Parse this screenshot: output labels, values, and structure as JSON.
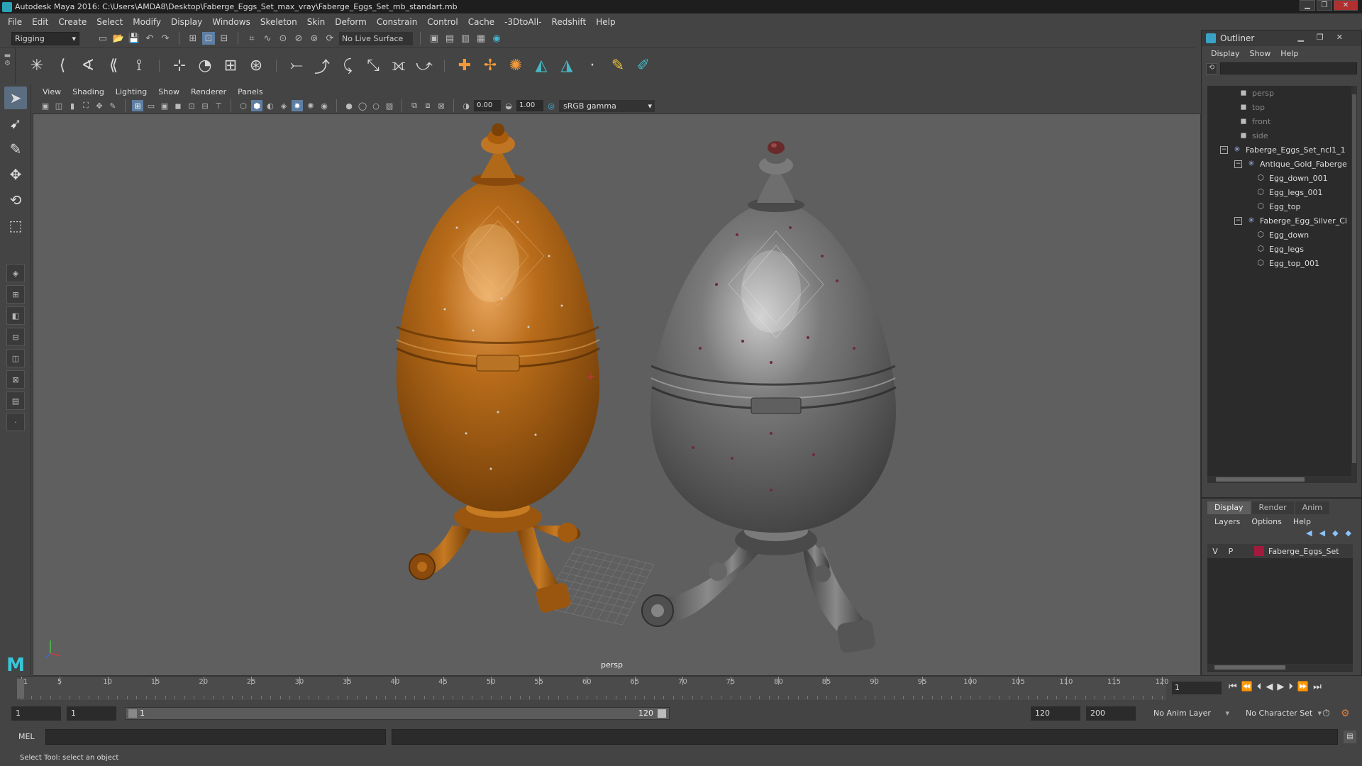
{
  "window": {
    "title": "Autodesk Maya 2016: C:\\Users\\AMDA8\\Desktop\\Faberge_Eggs_Set_max_vray\\Faberge_Eggs_Set_mb_standart.mb",
    "controls": [
      "minimize",
      "maximize",
      "close"
    ]
  },
  "menubar": [
    "File",
    "Edit",
    "Create",
    "Select",
    "Modify",
    "Display",
    "Windows",
    "Skeleton",
    "Skin",
    "Deform",
    "Constrain",
    "Control",
    "Cache",
    "-3DtoAll-",
    "Redshift",
    "Help"
  ],
  "statusline": {
    "mode": "Rigging",
    "live_surface": "No Live Surface"
  },
  "viewport_panel": {
    "menus": [
      "View",
      "Shading",
      "Lighting",
      "Show",
      "Renderer",
      "Panels"
    ],
    "exposure": "0.00",
    "gamma_value": "1.00",
    "color_space": "sRGB gamma",
    "camera_label": "persp",
    "objects": [
      {
        "name": "Antique Gold Faberge Egg",
        "color": "#a85c0c"
      },
      {
        "name": "Faberge Egg Silver",
        "color": "#6e6e6e"
      }
    ]
  },
  "outliner": {
    "title": "Outliner",
    "menus": [
      "Display",
      "Show",
      "Help"
    ],
    "items": [
      {
        "label": "persp",
        "type": "camera",
        "level": 0
      },
      {
        "label": "top",
        "type": "camera",
        "level": 0
      },
      {
        "label": "front",
        "type": "camera",
        "level": 0
      },
      {
        "label": "side",
        "type": "camera",
        "level": 0
      },
      {
        "label": "Faberge_Eggs_Set_ncl1_1",
        "type": "group",
        "level": 0,
        "expand": "−"
      },
      {
        "label": "Antique_Gold_Faberge",
        "type": "group",
        "level": 1,
        "expand": "−"
      },
      {
        "label": "Egg_down_001",
        "type": "mesh",
        "level": 2
      },
      {
        "label": "Egg_legs_001",
        "type": "mesh",
        "level": 2
      },
      {
        "label": "Egg_top",
        "type": "mesh",
        "level": 2
      },
      {
        "label": "Faberge_Egg_Silver_Cl",
        "type": "group",
        "level": 1,
        "expand": "−"
      },
      {
        "label": "Egg_down",
        "type": "mesh",
        "level": 2
      },
      {
        "label": "Egg_legs",
        "type": "mesh",
        "level": 2
      },
      {
        "label": "Egg_top_001",
        "type": "mesh",
        "level": 2
      }
    ]
  },
  "layer_editor": {
    "tabs": [
      "Display",
      "Render",
      "Anim"
    ],
    "active_tab": "Display",
    "menus": [
      "Layers",
      "Options",
      "Help"
    ],
    "layers": [
      {
        "v": "V",
        "p": "P",
        "name": "Faberge_Eggs_Set",
        "color": "#a31a3d"
      }
    ]
  },
  "timeline": {
    "tick_labels": [
      "1",
      "5",
      "10",
      "15",
      "20",
      "25",
      "30",
      "35",
      "40",
      "45",
      "50",
      "55",
      "60",
      "65",
      "70",
      "75",
      "80",
      "85",
      "90",
      "95",
      "100",
      "105",
      "110",
      "115",
      "120"
    ],
    "current_frame": "1"
  },
  "range": {
    "start": "1",
    "playback_start": "1",
    "bar_start": "1",
    "bar_end": "120",
    "playback_end": "120",
    "end": "200",
    "anim_layer": "No Anim Layer",
    "character_set": "No Character Set"
  },
  "cmdline": {
    "label": "MEL"
  },
  "helpline": {
    "text": "Select Tool: select an object"
  }
}
